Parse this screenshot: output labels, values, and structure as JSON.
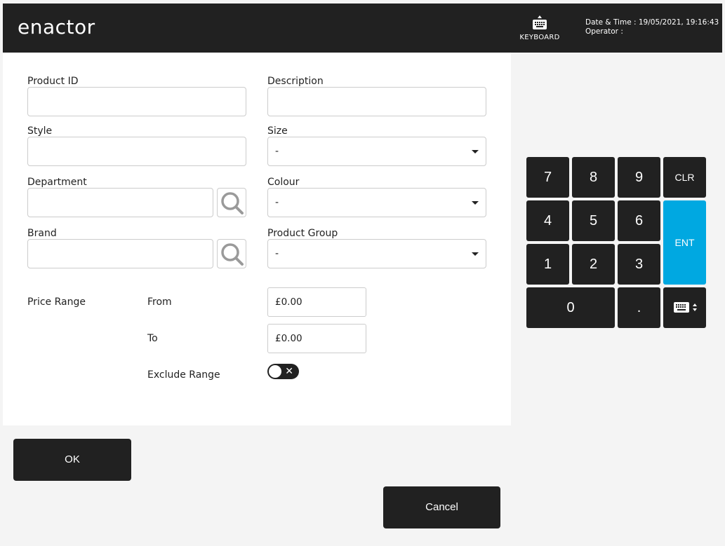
{
  "header": {
    "logo": "enactor",
    "keyboard_label": "KEYBOARD",
    "datetime": "Date & Time : 19/05/2021, 19:16:43",
    "operator": "Operator :"
  },
  "form": {
    "product_id": {
      "label": "Product ID",
      "value": ""
    },
    "description": {
      "label": "Description",
      "value": ""
    },
    "style": {
      "label": "Style",
      "value": ""
    },
    "size": {
      "label": "Size",
      "value": "-"
    },
    "department": {
      "label": "Department",
      "value": ""
    },
    "colour": {
      "label": "Colour",
      "value": "-"
    },
    "brand": {
      "label": "Brand",
      "value": ""
    },
    "product_group": {
      "label": "Product Group",
      "value": "-"
    },
    "price_range": {
      "label": "Price Range",
      "from_label": "From",
      "from_value": "£0.00",
      "to_label": "To",
      "to_value": "£0.00",
      "exclude_label": "Exclude Range",
      "exclude_enabled": false
    }
  },
  "keypad": {
    "keys": {
      "k7": "7",
      "k8": "8",
      "k9": "9",
      "clr": "CLR",
      "k4": "4",
      "k5": "5",
      "k6": "6",
      "ent": "ENT",
      "k1": "1",
      "k2": "2",
      "k3": "3",
      "k0": "0",
      "dot": "."
    }
  },
  "actions": {
    "ok": "OK",
    "cancel": "Cancel"
  },
  "colors": {
    "dark": "#212121",
    "accent": "#00a8e1",
    "background": "#f4f4f4"
  }
}
